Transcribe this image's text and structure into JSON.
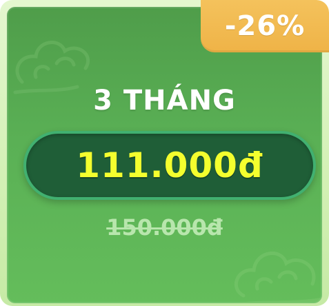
{
  "offer": {
    "discount": "-26%",
    "plan": "3 THÁNG",
    "price": "111.000đ",
    "original_price": "150.000đ"
  },
  "colors": {
    "card_green": "#5ab055",
    "pill_green": "#1f5e37",
    "price_yellow": "#f4ff2e",
    "badge_orange": "#efb347"
  }
}
